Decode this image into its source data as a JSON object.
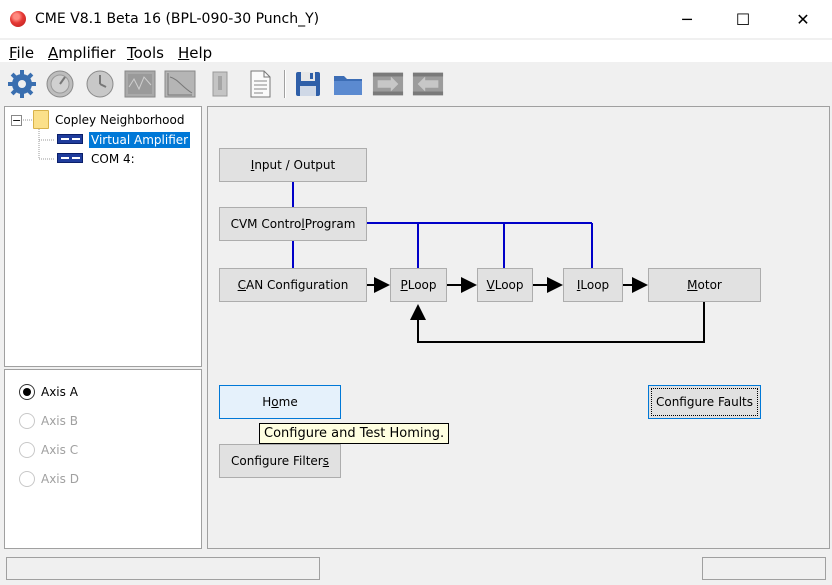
{
  "window": {
    "title": "CME V8.1 Beta 16 (BPL-090-30 Punch_Y)",
    "minimize_glyph": "─",
    "maximize_glyph": "☐",
    "close_glyph": "✕"
  },
  "menu": [
    {
      "accel": "F",
      "rest": "ile"
    },
    {
      "accel": "A",
      "rest": "mplifier"
    },
    {
      "accel": "T",
      "rest": "ools"
    },
    {
      "accel": "H",
      "rest": "elp"
    }
  ],
  "toolbar_icons": [
    "gear-icon",
    "dial-icon",
    "clock-icon",
    "scope-icon",
    "chart-icon",
    "tool-icon",
    "document-icon",
    "save-icon",
    "folder-icon",
    "download-icon",
    "upload-icon"
  ],
  "tree": {
    "root": "Copley  Neighborhood",
    "children": [
      "Virtual Amplifier",
      "COM 4:"
    ],
    "expander": "−"
  },
  "axes": [
    {
      "label": "Axis A",
      "checked": true,
      "enabled": true
    },
    {
      "label": "Axis B",
      "checked": false,
      "enabled": false
    },
    {
      "label": "Axis C",
      "checked": false,
      "enabled": false
    },
    {
      "label": "Axis D",
      "checked": false,
      "enabled": false
    }
  ],
  "blocks": {
    "io": {
      "pre": "",
      "accel": "I",
      "post": "nput / Output"
    },
    "cvm": {
      "pre": "CVM  Contro",
      "accel": "l",
      "post": " Program"
    },
    "can": {
      "pre": "",
      "accel": "C",
      "post": "AN Configuration"
    },
    "ploop": {
      "pre": "",
      "accel": "P",
      "post": " Loop"
    },
    "vloop": {
      "pre": "",
      "accel": "V",
      "post": " Loop"
    },
    "iloop": {
      "pre": "",
      "accel": "I",
      "post": " Loop"
    },
    "motor": {
      "pre": "",
      "accel": "M",
      "post": "otor"
    },
    "home": {
      "pre": "H",
      "accel": "o",
      "post": "me"
    },
    "faults": {
      "pre": "Configure Faults",
      "accel": "",
      "post": ""
    },
    "filters": {
      "pre": "Configure Filter",
      "accel": "s",
      "post": ""
    }
  },
  "tooltip": "Configure and Test Homing.",
  "colors": {
    "signal_line": "#0000c8",
    "feedback_line": "#000000",
    "selection": "#0078d7"
  }
}
